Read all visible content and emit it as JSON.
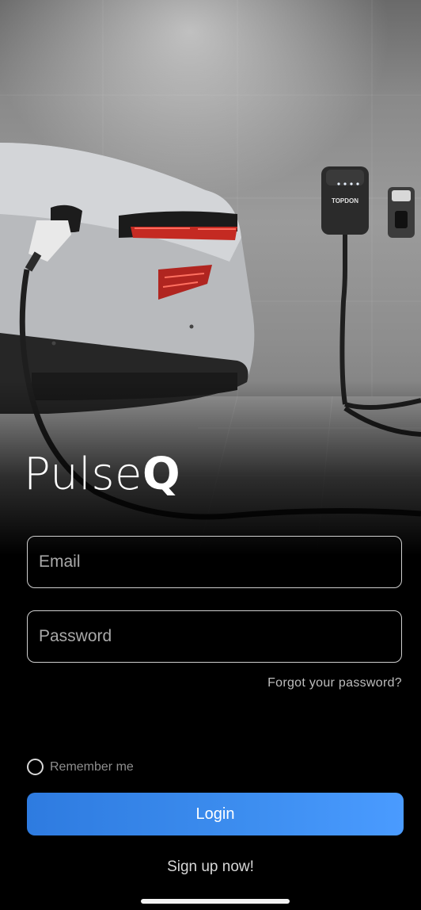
{
  "brand": {
    "logo_base": "Pulse",
    "logo_accent": "Q"
  },
  "hero": {
    "charger_brand": "TOPDON"
  },
  "form": {
    "email_placeholder": "Email",
    "password_placeholder": "Password",
    "forgot_label": "Forgot your password?",
    "remember_label": "Remember me",
    "remember_checked": false,
    "login_label": "Login",
    "signup_label": "Sign up now!"
  },
  "colors": {
    "accent": "#3d8ef0",
    "background": "#000000"
  }
}
